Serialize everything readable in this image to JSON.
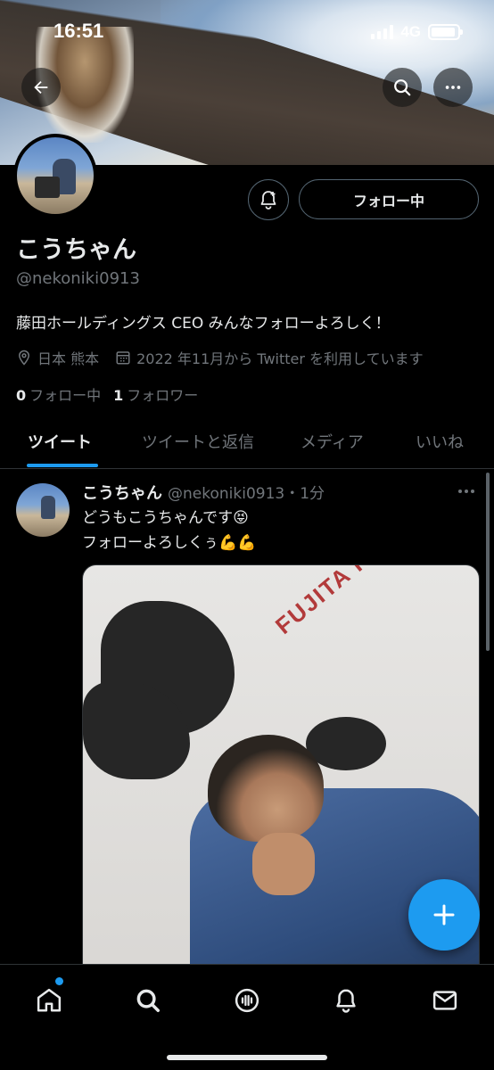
{
  "status_bar": {
    "time": "16:51",
    "network": "4G"
  },
  "profile": {
    "display_name": "こうちゃん",
    "handle": "@nekoniki0913",
    "bio": "藤田ホールディングス CEO みんなフォローよろしく！",
    "location": "日本 熊本",
    "joined": "2022 年11月から Twitter を利用しています",
    "following_count": "0",
    "following_label": "フォロー中",
    "followers_count": "1",
    "followers_label": "フォロワー",
    "follow_button_label": "フォロー中"
  },
  "tabs": [
    {
      "label": "ツイート",
      "active": true
    },
    {
      "label": "ツイートと返信",
      "active": false
    },
    {
      "label": "メディア",
      "active": false
    },
    {
      "label": "いいね",
      "active": false
    }
  ],
  "tweet": {
    "name": "こうちゃん",
    "handle_time": "@nekoniki0913・1分",
    "line1": "どうもこうちゃんです😝",
    "line2": "フォローよろしくぅ💪💪",
    "media_text": "FUJITA H"
  },
  "icons": {
    "back": "back-arrow-icon",
    "search": "search-icon",
    "more": "more-icon",
    "notify": "notification-plus-icon",
    "location": "location-pin-icon",
    "calendar": "calendar-icon",
    "compose": "plus-icon",
    "nav": [
      "home-icon",
      "search-icon",
      "spaces-icon",
      "notifications-icon",
      "messages-icon"
    ]
  },
  "colors": {
    "accent": "#1d9bf0",
    "background": "#000000",
    "muted": "#71767b",
    "text": "#e7e9ea"
  }
}
